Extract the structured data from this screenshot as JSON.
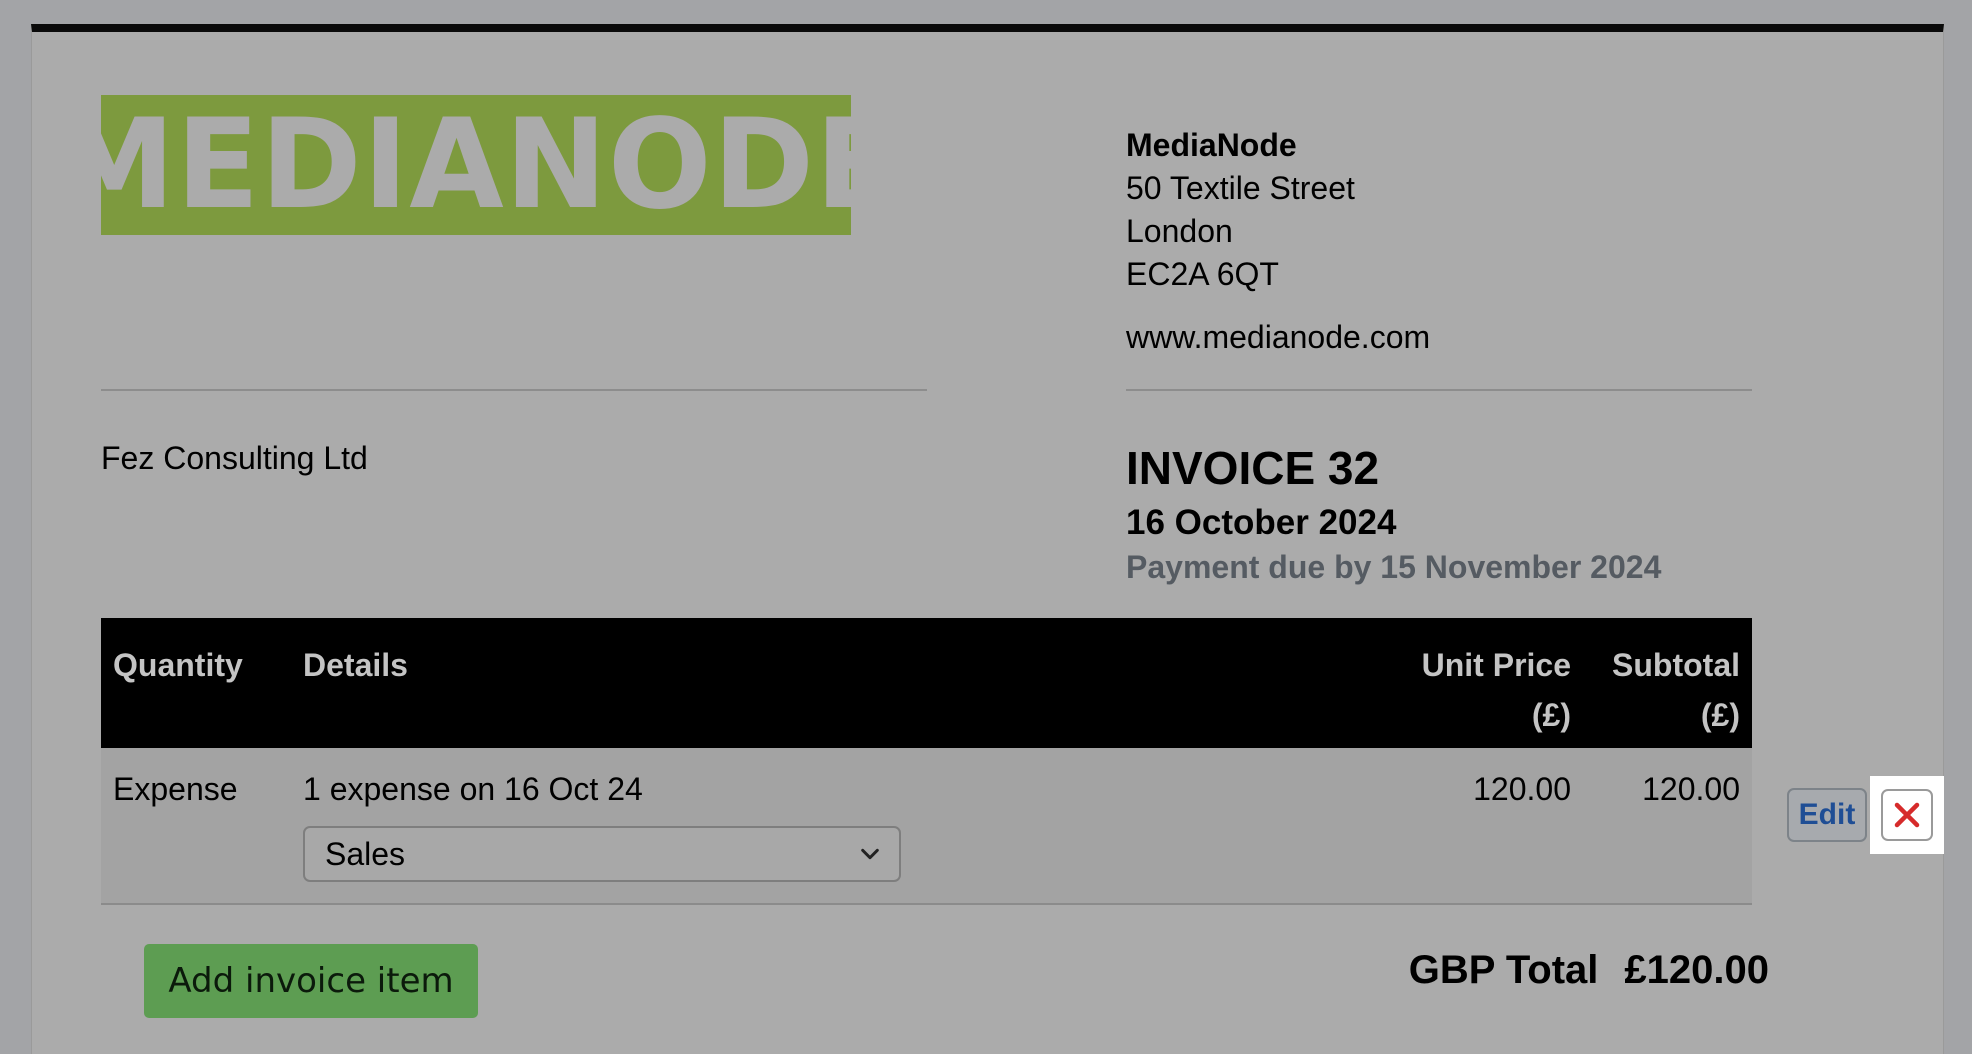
{
  "logo": {
    "text": "MEDIANODE",
    "color": "#7d9a3e"
  },
  "company": {
    "name": "MediaNode",
    "address_lines": [
      "50 Textile Street",
      "London",
      "EC2A 6QT"
    ],
    "website": "www.medianode.com"
  },
  "client": {
    "name": "Fez Consulting Ltd"
  },
  "invoice": {
    "title": "INVOICE 32",
    "date": "16 October 2024",
    "due": "Payment due by 15 November 2024"
  },
  "table": {
    "headers": {
      "quantity": "Quantity",
      "details": "Details",
      "unit_price": [
        "Unit Price",
        "(£)"
      ],
      "subtotal": [
        "Subtotal",
        "(£)"
      ]
    },
    "rows": [
      {
        "quantity": "Expense",
        "details": "1 expense on 16 Oct 24",
        "category": "Sales",
        "unit_price": "120.00",
        "subtotal": "120.00"
      }
    ]
  },
  "actions": {
    "edit_label": "Edit",
    "delete_icon": "close-icon",
    "add_label": "Add invoice item"
  },
  "totals": {
    "label": "GBP Total",
    "value": "£120.00"
  },
  "colors": {
    "accent_green": "#5d9d52",
    "delete_red": "#d62b2b",
    "link_blue": "#1f4e95"
  }
}
